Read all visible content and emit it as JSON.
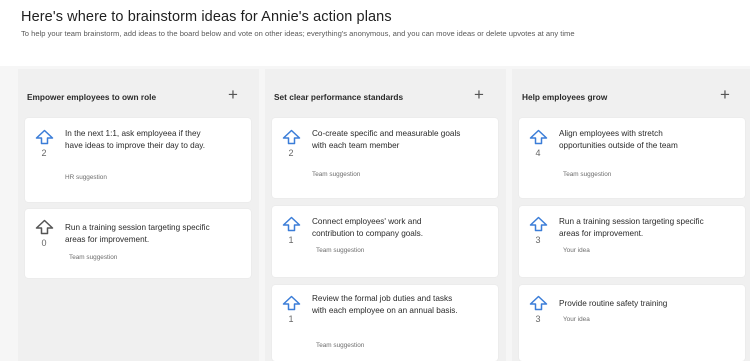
{
  "header": {
    "title": "Here's where to brainstorm ideas for Annie's action plans",
    "subtitle": "To help your team brainstorm, add ideas to the board below and vote on other ideas; everything's anonymous, and you can move ideas or delete upvotes at any time"
  },
  "columns": [
    {
      "title": "Empower employees to own role",
      "add_label": "+",
      "cards": [
        {
          "text": "In the next 1:1, ask employeea if they have ideas to improve their day to day.",
          "votes": "2",
          "source": "HR suggestion"
        },
        {
          "text": "Run a training session targeting specific areas for improvement.",
          "votes": "0",
          "source": "Team suggestion"
        }
      ]
    },
    {
      "title": "Set clear performance standards",
      "add_label": "+",
      "cards": [
        {
          "text": "Co-create specific and measurable goals with each team member",
          "votes": "2",
          "source": "Team suggestion"
        },
        {
          "text": "Connect employees' work and contribution to company goals.",
          "votes": "1",
          "source": "Team suggestion"
        },
        {
          "text": "Review the formal job duties and tasks with each employee on an annual basis.",
          "votes": "1",
          "source": "Team suggestion"
        }
      ]
    },
    {
      "title": "Help employees grow",
      "add_label": "+",
      "cards": [
        {
          "text": "Align employees with stretch opportunities outside of the team",
          "votes": "4",
          "source": "Team suggestion"
        },
        {
          "text": "Run a training session targeting specific areas for improvement.",
          "votes": "3",
          "source": "Your idea"
        },
        {
          "text": "Provide routine safety training",
          "votes": "3",
          "source": "Your idea"
        }
      ]
    }
  ],
  "icons": {
    "upvote": "upvote-arrow-icon",
    "add": "plus-icon"
  },
  "colors": {
    "upvote": "#3b7dd8",
    "board_bg": "#f6f6f6",
    "column_bg": "#f0f0f0"
  }
}
